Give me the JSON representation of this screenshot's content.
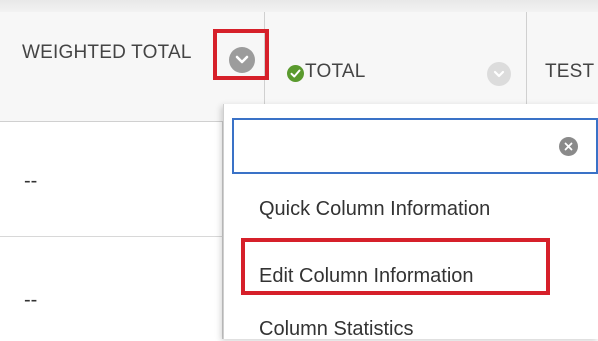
{
  "columns": {
    "weighted_total": {
      "label": "WEIGHTED TOTAL"
    },
    "total": {
      "label": "TOTAL"
    },
    "test": {
      "label": "TEST"
    }
  },
  "rows": [
    {
      "weighted_total": "--"
    },
    {
      "weighted_total": "--"
    }
  ],
  "context_menu": {
    "search": {
      "value": ""
    },
    "items": [
      {
        "label": "Quick Column Information"
      },
      {
        "label": "Edit Column Information"
      },
      {
        "label": "Column Statistics"
      }
    ]
  },
  "colors": {
    "highlight": "#d6202a",
    "search_border": "#3a72c7",
    "check": "#5a9a2e"
  },
  "icons": [
    "chevron-down-icon",
    "check-circle-icon",
    "clear-icon"
  ]
}
